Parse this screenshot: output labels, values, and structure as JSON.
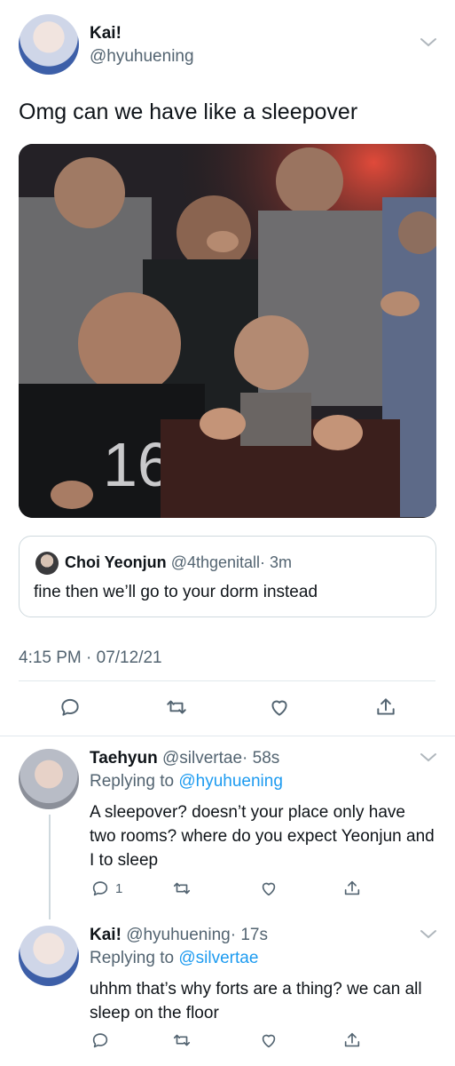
{
  "main_tweet": {
    "display_name": "Kai!",
    "handle": "@hyuhuening",
    "text": "Omg can we have like a sleepover",
    "timestamp": "4:15 PM · 07/12/21",
    "quote": {
      "display_name": "Choi Yeonjun",
      "handle": "@4thgenitall",
      "time": "· 3m",
      "text": "fine then we’ll go to your dorm instead"
    }
  },
  "replies": [
    {
      "display_name": "Taehyun",
      "handle": "@silvertae",
      "time": "· 58s",
      "replying_prefix": "Replying to",
      "replying_to": "@hyuhuening",
      "text": "A sleepover? doesn’t your place only have two rooms? where do you expect Yeonjun and I to sleep",
      "reply_count": "1"
    },
    {
      "display_name": "Kai!",
      "handle": "@hyuhuening",
      "time": "· 17s",
      "replying_prefix": "Replying to",
      "replying_to": "@silvertae",
      "text": "uhhm that’s why forts are a thing? we can all sleep on the floor",
      "reply_count": ""
    }
  ],
  "icons": [
    "chevron-down-icon",
    "reply-icon",
    "retweet-icon",
    "like-icon",
    "share-icon"
  ],
  "colors": {
    "link": "#1d9bf0",
    "muted": "#536471",
    "text": "#0f1419",
    "divider": "#e1e8ed"
  }
}
